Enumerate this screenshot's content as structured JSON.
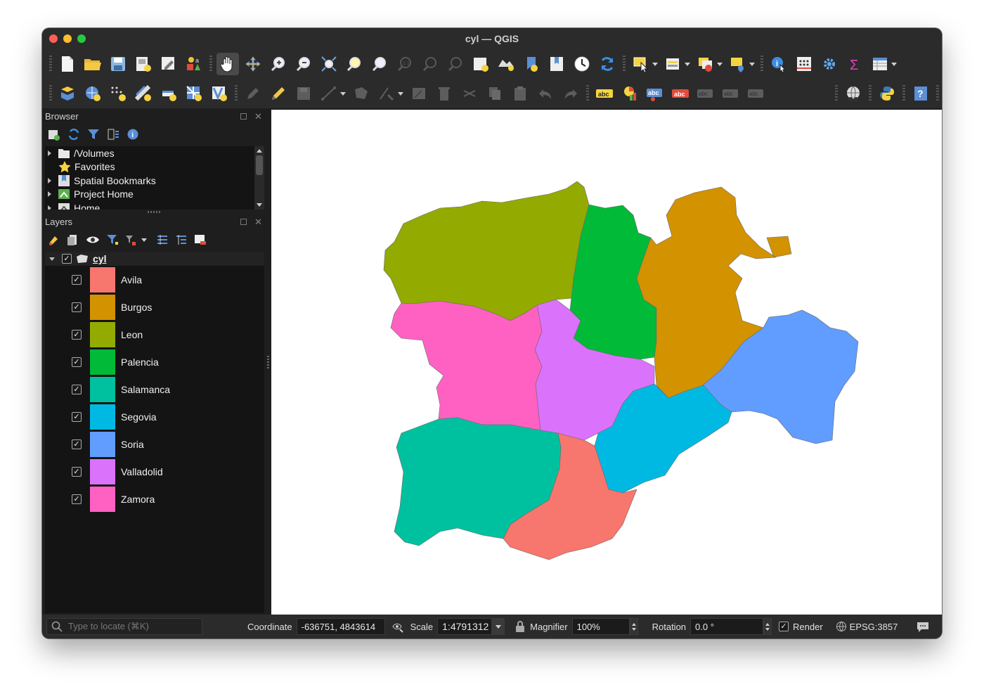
{
  "window": {
    "title": "cyl — QGIS"
  },
  "toolbar1": {
    "icons": [
      "new-project-icon",
      "open-project-icon",
      "save-project-icon",
      "new-print-layout-icon",
      "layout-manager-icon",
      "style-manager-icon",
      "pan-icon",
      "pan-to-selection-icon",
      "zoom-in-icon",
      "zoom-out-icon",
      "zoom-full-icon",
      "zoom-to-selection-icon",
      "zoom-to-layer-icon",
      "zoom-native-icon",
      "zoom-last-icon",
      "zoom-next-icon",
      "new-map-view-icon",
      "new-3d-view-icon",
      "new-bookmark-icon",
      "show-bookmarks-icon",
      "temporal-controller-icon",
      "refresh-icon",
      "select-features-icon",
      "select-by-value-icon",
      "deselect-icon",
      "select-by-location-icon",
      "identify-icon",
      "attribute-table-icon",
      "settings-icon",
      "statistics-icon",
      "open-table-icon"
    ]
  },
  "toolbar2": {
    "icons": [
      "data-source-manager-icon",
      "new-geopackage-icon",
      "new-temporary-layer-icon",
      "new-shapefile-icon",
      "virtual-layer-icon",
      "mesh-layer-icon",
      "new-vector-tile-icon",
      "current-edits-icon",
      "toggle-editing-icon",
      "save-edits-icon",
      "digitize-icon",
      "add-polygon-icon",
      "vertex-tool-icon",
      "modify-attributes-icon",
      "delete-selected-icon",
      "cut-features-icon",
      "copy-features-icon",
      "paste-features-icon",
      "undo-icon",
      "redo-icon",
      "label-toolbar-icon",
      "diagram-icon",
      "label-pin-icon",
      "label-highlight-icon",
      "label-move-icon",
      "label-rotate-icon",
      "label-change-icon",
      "globe-plugin-icon",
      "python-console-icon",
      "help-icon"
    ]
  },
  "browser": {
    "title": "Browser",
    "toolbar_icons": [
      "add-layer-icon",
      "refresh-icon",
      "filter-icon",
      "collapse-all-icon",
      "info-icon"
    ],
    "items": [
      {
        "label": "/Volumes",
        "icon": "folder-icon"
      },
      {
        "label": "Favorites",
        "icon": "star-icon"
      },
      {
        "label": "Spatial Bookmarks",
        "icon": "bookmark-icon"
      },
      {
        "label": "Project Home",
        "icon": "project-home-icon"
      },
      {
        "label": "Home",
        "icon": "home-folder-icon"
      }
    ]
  },
  "layers": {
    "title": "Layers",
    "toolbar_icons": [
      "style-panel-icon",
      "add-group-icon",
      "visibility-icon",
      "filter-legend-icon",
      "filter-expression-icon",
      "expand-all-icon",
      "collapse-all-icon",
      "remove-layer-icon"
    ],
    "group": {
      "name": "cyl",
      "checked": true
    },
    "items": [
      {
        "label": "Avila",
        "color": "#f7766d",
        "checked": true
      },
      {
        "label": "Burgos",
        "color": "#d39200",
        "checked": true
      },
      {
        "label": "Leon",
        "color": "#93aa00",
        "checked": true
      },
      {
        "label": "Palencia",
        "color": "#00ba38",
        "checked": true
      },
      {
        "label": "Salamanca",
        "color": "#00c19f",
        "checked": true
      },
      {
        "label": "Segovia",
        "color": "#00b9e3",
        "checked": true
      },
      {
        "label": "Soria",
        "color": "#619cff",
        "checked": true
      },
      {
        "label": "Valladolid",
        "color": "#db72fb",
        "checked": true
      },
      {
        "label": "Zamora",
        "color": "#ff61c3",
        "checked": true
      }
    ]
  },
  "statusbar": {
    "locate_placeholder": "Type to locate (⌘K)",
    "coordinate_label": "Coordinate",
    "coordinate_value": "-636751, 4843614",
    "scale_label": "Scale",
    "scale_value": "1:4791312",
    "magnifier_label": "Magnifier",
    "magnifier_value": "100%",
    "rotation_label": "Rotation",
    "rotation_value": "0.0 °",
    "render_label": "Render",
    "render_checked": true,
    "crs": "EPSG:3857"
  }
}
